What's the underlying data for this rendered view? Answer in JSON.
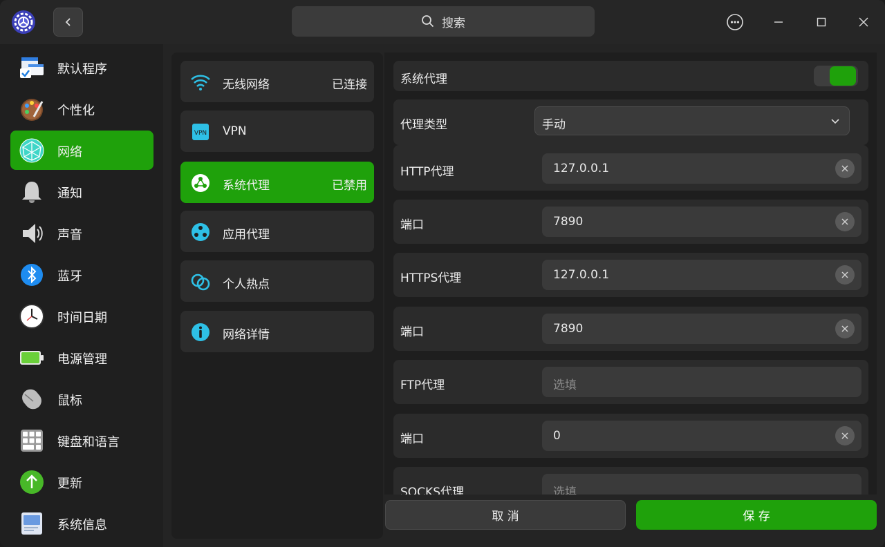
{
  "titlebar": {
    "search_placeholder": "搜索"
  },
  "sidebar": {
    "items": [
      {
        "label": "默认程序",
        "icon": "default-apps-icon"
      },
      {
        "label": "个性化",
        "icon": "personalization-icon"
      },
      {
        "label": "网络",
        "icon": "network-icon",
        "active": true
      },
      {
        "label": "通知",
        "icon": "bell-icon"
      },
      {
        "label": "声音",
        "icon": "speaker-icon"
      },
      {
        "label": "蓝牙",
        "icon": "bluetooth-icon"
      },
      {
        "label": "时间日期",
        "icon": "clock-icon"
      },
      {
        "label": "电源管理",
        "icon": "battery-icon"
      },
      {
        "label": "鼠标",
        "icon": "mouse-icon"
      },
      {
        "label": "键盘和语言",
        "icon": "keyboard-icon"
      },
      {
        "label": "更新",
        "icon": "update-icon"
      },
      {
        "label": "系统信息",
        "icon": "system-info-icon"
      }
    ]
  },
  "network_menu": {
    "items": [
      {
        "label": "无线网络",
        "status": "已连接",
        "icon": "wifi-icon"
      },
      {
        "label": "VPN",
        "status": "",
        "icon": "vpn-icon",
        "icon_text": "VPN"
      },
      {
        "label": "系统代理",
        "status": "已禁用",
        "icon": "proxy-icon",
        "active": true
      },
      {
        "label": "应用代理",
        "status": "",
        "icon": "app-proxy-icon"
      },
      {
        "label": "个人热点",
        "status": "",
        "icon": "hotspot-icon"
      },
      {
        "label": "网络详情",
        "status": "",
        "icon": "info-icon"
      }
    ]
  },
  "proxy": {
    "system_proxy_label": "系统代理",
    "system_proxy_enabled": true,
    "proxy_type_label": "代理类型",
    "proxy_type_value": "手动",
    "http_label": "HTTP代理",
    "http_value": "127.0.0.1",
    "http_port_label": "端口",
    "http_port_value": "7890",
    "https_label": "HTTPS代理",
    "https_value": "127.0.0.1",
    "https_port_label": "端口",
    "https_port_value": "7890",
    "ftp_label": "FTP代理",
    "ftp_placeholder": "选填",
    "ftp_port_label": "端口",
    "ftp_port_value": "0",
    "socks_label": "SOCKS代理",
    "socks_placeholder": "选填"
  },
  "actions": {
    "cancel_label": "取 消",
    "save_label": "保 存"
  },
  "colors": {
    "accent": "#1fa10b",
    "background": "#242424"
  }
}
